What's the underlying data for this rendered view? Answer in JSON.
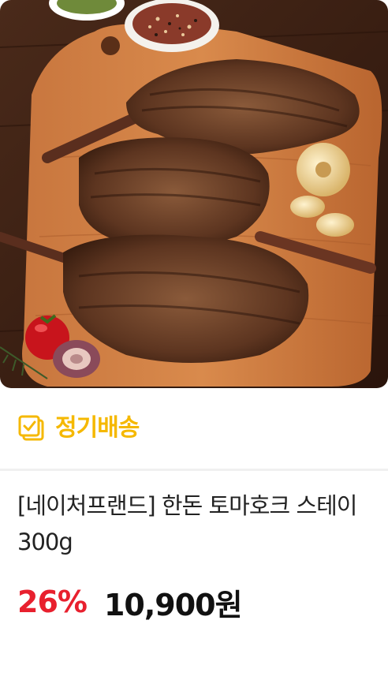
{
  "product": {
    "image_alt": "Grilled tomahawk pork steaks on a wooden board",
    "badge_label": "정기배송",
    "badge_icon": "calendar-check-icon",
    "title": "[네이처프랜드] 한돈 토마호크 스테이 300g",
    "discount": "26%",
    "price": "10,900원"
  },
  "colors": {
    "badge": "#f5b800",
    "discount": "#e8202e",
    "price": "#111111",
    "title": "#222222",
    "divider": "#f0f0f0"
  }
}
